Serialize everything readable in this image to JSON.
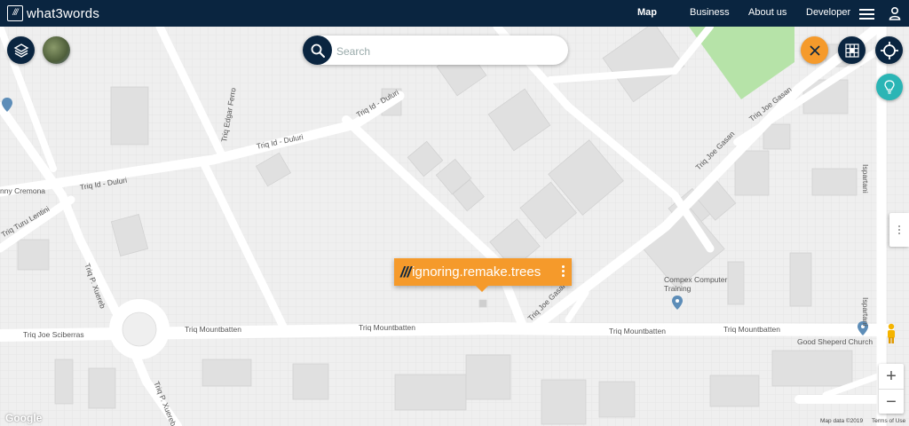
{
  "brand": {
    "logo_mark": "///",
    "name": "what3words"
  },
  "nav": {
    "items": [
      "Map",
      "Business",
      "About us",
      "Developer"
    ],
    "active": "Map"
  },
  "search": {
    "placeholder": "Search"
  },
  "popup": {
    "slashes": "///",
    "address": "ignoring.remake.trees"
  },
  "map": {
    "street_labels": [
      "Triq Edgar Ferro",
      "Triq Id - Duluri",
      "Triq Id - Duluri",
      "Triq Id - Duluri",
      "nny Cremona",
      "Triq Turu Lentini",
      "Triq P. Xuereb",
      "Triq Joe Sciberras",
      "Triq Mountbatten",
      "Triq Mountbatten",
      "Triq Mountbatten",
      "Triq Mountbatten",
      "Triq Joe Gasan",
      "Triq Joe Gasan",
      "Triq Joe Gasan",
      "Triq P. Xuereb",
      "Ispartani",
      "Ispartani"
    ],
    "places": [
      {
        "name": "Compex Computer Training"
      },
      {
        "name": "Good Sheperd Church"
      }
    ],
    "attribution": {
      "google": "Google",
      "map_data": "Map data ©2019",
      "terms": "Terms of Use"
    }
  },
  "controls": {
    "zoom_in": "+",
    "zoom_out": "−",
    "close": "×"
  },
  "colors": {
    "nav_bg": "#0a2540",
    "accent_orange": "#f59a2b",
    "teal": "#2bb5b5",
    "park_green": "#b6e3a8"
  },
  "icons": [
    "layers-icon",
    "satellite-thumbnail",
    "search-icon",
    "close-icon",
    "grid-icon",
    "locate-icon",
    "lightbulb-icon",
    "pegman-icon",
    "menu-icon",
    "user-icon"
  ]
}
